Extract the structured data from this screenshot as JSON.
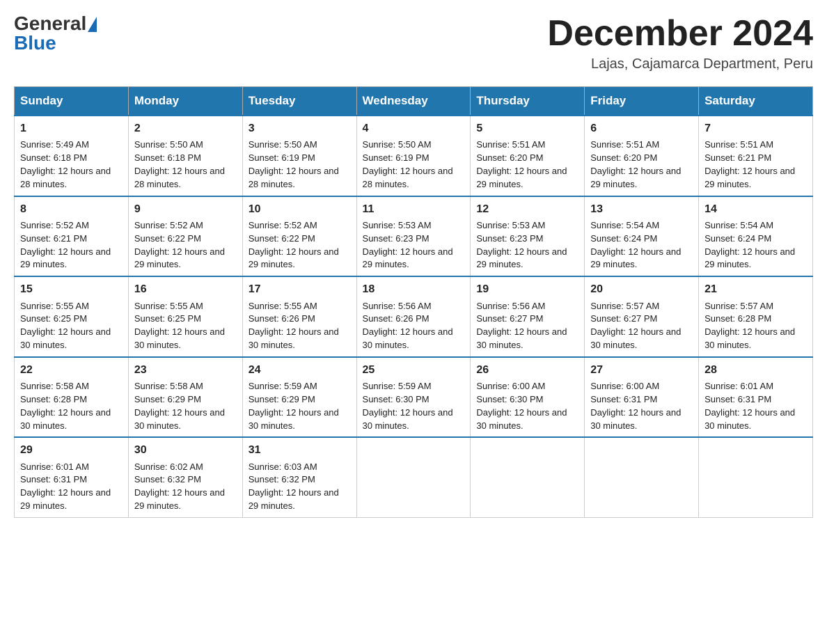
{
  "logo": {
    "general": "General",
    "blue": "Blue"
  },
  "header": {
    "month": "December 2024",
    "location": "Lajas, Cajamarca Department, Peru"
  },
  "days": [
    "Sunday",
    "Monday",
    "Tuesday",
    "Wednesday",
    "Thursday",
    "Friday",
    "Saturday"
  ],
  "weeks": [
    [
      {
        "num": "1",
        "sunrise": "5:49 AM",
        "sunset": "6:18 PM",
        "daylight": "12 hours and 28 minutes."
      },
      {
        "num": "2",
        "sunrise": "5:50 AM",
        "sunset": "6:18 PM",
        "daylight": "12 hours and 28 minutes."
      },
      {
        "num": "3",
        "sunrise": "5:50 AM",
        "sunset": "6:19 PM",
        "daylight": "12 hours and 28 minutes."
      },
      {
        "num": "4",
        "sunrise": "5:50 AM",
        "sunset": "6:19 PM",
        "daylight": "12 hours and 28 minutes."
      },
      {
        "num": "5",
        "sunrise": "5:51 AM",
        "sunset": "6:20 PM",
        "daylight": "12 hours and 29 minutes."
      },
      {
        "num": "6",
        "sunrise": "5:51 AM",
        "sunset": "6:20 PM",
        "daylight": "12 hours and 29 minutes."
      },
      {
        "num": "7",
        "sunrise": "5:51 AM",
        "sunset": "6:21 PM",
        "daylight": "12 hours and 29 minutes."
      }
    ],
    [
      {
        "num": "8",
        "sunrise": "5:52 AM",
        "sunset": "6:21 PM",
        "daylight": "12 hours and 29 minutes."
      },
      {
        "num": "9",
        "sunrise": "5:52 AM",
        "sunset": "6:22 PM",
        "daylight": "12 hours and 29 minutes."
      },
      {
        "num": "10",
        "sunrise": "5:52 AM",
        "sunset": "6:22 PM",
        "daylight": "12 hours and 29 minutes."
      },
      {
        "num": "11",
        "sunrise": "5:53 AM",
        "sunset": "6:23 PM",
        "daylight": "12 hours and 29 minutes."
      },
      {
        "num": "12",
        "sunrise": "5:53 AM",
        "sunset": "6:23 PM",
        "daylight": "12 hours and 29 minutes."
      },
      {
        "num": "13",
        "sunrise": "5:54 AM",
        "sunset": "6:24 PM",
        "daylight": "12 hours and 29 minutes."
      },
      {
        "num": "14",
        "sunrise": "5:54 AM",
        "sunset": "6:24 PM",
        "daylight": "12 hours and 29 minutes."
      }
    ],
    [
      {
        "num": "15",
        "sunrise": "5:55 AM",
        "sunset": "6:25 PM",
        "daylight": "12 hours and 30 minutes."
      },
      {
        "num": "16",
        "sunrise": "5:55 AM",
        "sunset": "6:25 PM",
        "daylight": "12 hours and 30 minutes."
      },
      {
        "num": "17",
        "sunrise": "5:55 AM",
        "sunset": "6:26 PM",
        "daylight": "12 hours and 30 minutes."
      },
      {
        "num": "18",
        "sunrise": "5:56 AM",
        "sunset": "6:26 PM",
        "daylight": "12 hours and 30 minutes."
      },
      {
        "num": "19",
        "sunrise": "5:56 AM",
        "sunset": "6:27 PM",
        "daylight": "12 hours and 30 minutes."
      },
      {
        "num": "20",
        "sunrise": "5:57 AM",
        "sunset": "6:27 PM",
        "daylight": "12 hours and 30 minutes."
      },
      {
        "num": "21",
        "sunrise": "5:57 AM",
        "sunset": "6:28 PM",
        "daylight": "12 hours and 30 minutes."
      }
    ],
    [
      {
        "num": "22",
        "sunrise": "5:58 AM",
        "sunset": "6:28 PM",
        "daylight": "12 hours and 30 minutes."
      },
      {
        "num": "23",
        "sunrise": "5:58 AM",
        "sunset": "6:29 PM",
        "daylight": "12 hours and 30 minutes."
      },
      {
        "num": "24",
        "sunrise": "5:59 AM",
        "sunset": "6:29 PM",
        "daylight": "12 hours and 30 minutes."
      },
      {
        "num": "25",
        "sunrise": "5:59 AM",
        "sunset": "6:30 PM",
        "daylight": "12 hours and 30 minutes."
      },
      {
        "num": "26",
        "sunrise": "6:00 AM",
        "sunset": "6:30 PM",
        "daylight": "12 hours and 30 minutes."
      },
      {
        "num": "27",
        "sunrise": "6:00 AM",
        "sunset": "6:31 PM",
        "daylight": "12 hours and 30 minutes."
      },
      {
        "num": "28",
        "sunrise": "6:01 AM",
        "sunset": "6:31 PM",
        "daylight": "12 hours and 30 minutes."
      }
    ],
    [
      {
        "num": "29",
        "sunrise": "6:01 AM",
        "sunset": "6:31 PM",
        "daylight": "12 hours and 29 minutes."
      },
      {
        "num": "30",
        "sunrise": "6:02 AM",
        "sunset": "6:32 PM",
        "daylight": "12 hours and 29 minutes."
      },
      {
        "num": "31",
        "sunrise": "6:03 AM",
        "sunset": "6:32 PM",
        "daylight": "12 hours and 29 minutes."
      },
      null,
      null,
      null,
      null
    ]
  ],
  "labels": {
    "sunrise": "Sunrise:",
    "sunset": "Sunset:",
    "daylight": "Daylight:"
  }
}
